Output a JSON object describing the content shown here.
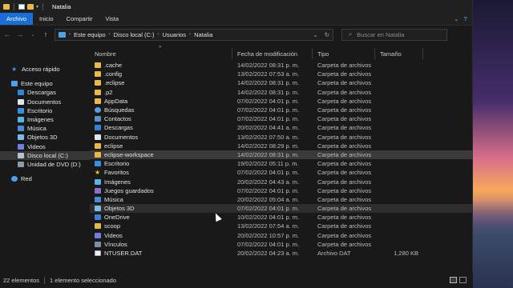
{
  "window": {
    "title": "Natalia"
  },
  "ribbon": {
    "tabs": [
      {
        "label": "Archivo",
        "active": true
      },
      {
        "label": "Inicio",
        "active": false
      },
      {
        "label": "Compartir",
        "active": false
      },
      {
        "label": "Vista",
        "active": false
      }
    ],
    "help_label": "?"
  },
  "address": {
    "crumbs": [
      "Este equipo",
      "Disco local (C:)",
      "Usuarios",
      "Natalia"
    ],
    "search_placeholder": "Buscar en Natalia"
  },
  "sidebar": {
    "items": [
      {
        "label": "Acceso rápido",
        "icon": "star-icon",
        "level": 1,
        "selected": false
      },
      {
        "label": "Este equipo",
        "icon": "computer-icon",
        "level": 1,
        "selected": false
      },
      {
        "label": "Descargas",
        "icon": "download-icon",
        "level": 2,
        "selected": false
      },
      {
        "label": "Documentos",
        "icon": "documents-icon",
        "level": 2,
        "selected": false
      },
      {
        "label": "Escritorio",
        "icon": "desktop-icon",
        "level": 2,
        "selected": false
      },
      {
        "label": "Imágenes",
        "icon": "pictures-icon",
        "level": 2,
        "selected": false
      },
      {
        "label": "Música",
        "icon": "music-icon",
        "level": 2,
        "selected": false
      },
      {
        "label": "Objetos 3D",
        "icon": "objects-3d-icon",
        "level": 2,
        "selected": false
      },
      {
        "label": "Videos",
        "icon": "video-icon",
        "level": 2,
        "selected": false
      },
      {
        "label": "Disco local (C:)",
        "icon": "drive-icon",
        "level": 2,
        "selected": true
      },
      {
        "label": "Unidad de DVD (D:)",
        "icon": "dvd-icon",
        "level": 2,
        "selected": false
      },
      {
        "label": "Red",
        "icon": "network-icon",
        "level": 1,
        "selected": false
      }
    ]
  },
  "columns": {
    "name": "Nombre",
    "date": "Fecha de modificación",
    "type": "Tipo",
    "size": "Tamaño"
  },
  "files": [
    {
      "name": ".cache",
      "date": "14/02/2022 08:31 p. m.",
      "type": "Carpeta de archivos",
      "size": "",
      "icon": "folder"
    },
    {
      "name": ".config",
      "date": "13/02/2022 07:53 a. m.",
      "type": "Carpeta de archivos",
      "size": "",
      "icon": "folder"
    },
    {
      "name": ".eclipse",
      "date": "14/02/2022 08:31 p. m.",
      "type": "Carpeta de archivos",
      "size": "",
      "icon": "folder"
    },
    {
      "name": ".p2",
      "date": "14/02/2022 08:31 p. m.",
      "type": "Carpeta de archivos",
      "size": "",
      "icon": "folder"
    },
    {
      "name": "AppData",
      "date": "07/02/2022 04:01 p. m.",
      "type": "Carpeta de archivos",
      "size": "",
      "icon": "folder"
    },
    {
      "name": "Búsquedas",
      "date": "07/02/2022 04:01 p. m.",
      "type": "Carpeta de archivos",
      "size": "",
      "icon": "searches"
    },
    {
      "name": "Contactos",
      "date": "07/02/2022 04:01 p. m.",
      "type": "Carpeta de archivos",
      "size": "",
      "icon": "contacts"
    },
    {
      "name": "Descargas",
      "date": "20/02/2022 04:41 a. m.",
      "type": "Carpeta de archivos",
      "size": "",
      "icon": "downloads"
    },
    {
      "name": "Documentos",
      "date": "13/02/2022 07:50 a. m.",
      "type": "Carpeta de archivos",
      "size": "",
      "icon": "documents"
    },
    {
      "name": "eclipse",
      "date": "14/02/2022 08:29 p. m.",
      "type": "Carpeta de archivos",
      "size": "",
      "icon": "folder"
    },
    {
      "name": "eclipse-workspace",
      "date": "14/02/2022 08:31 p. m.",
      "type": "Carpeta de archivos",
      "size": "",
      "icon": "folder",
      "highlight": true
    },
    {
      "name": "Escritorio",
      "date": "19/02/2022 05:11 p. m.",
      "type": "Carpeta de archivos",
      "size": "",
      "icon": "desktop"
    },
    {
      "name": "Favoritos",
      "date": "07/02/2022 04:01 p. m.",
      "type": "Carpeta de archivos",
      "size": "",
      "icon": "favorites"
    },
    {
      "name": "Imágenes",
      "date": "20/02/2022 04:43 a. m.",
      "type": "Carpeta de archivos",
      "size": "",
      "icon": "pictures"
    },
    {
      "name": "Juegos guardados",
      "date": "07/02/2022 04:01 p. m.",
      "type": "Carpeta de archivos",
      "size": "",
      "icon": "games"
    },
    {
      "name": "Música",
      "date": "20/02/2022 05:04 a. m.",
      "type": "Carpeta de archivos",
      "size": "",
      "icon": "music"
    },
    {
      "name": "Objetos 3D",
      "date": "07/02/2022 04:01 p. m.",
      "type": "Carpeta de archivos",
      "size": "",
      "icon": "objects3d",
      "hover": true
    },
    {
      "name": "OneDrive",
      "date": "10/02/2022 04:01 p. m.",
      "type": "Carpeta de archivos",
      "size": "",
      "icon": "onedrive"
    },
    {
      "name": "scoop",
      "date": "13/02/2022 07:54 a. m.",
      "type": "Carpeta de archivos",
      "size": "",
      "icon": "folder"
    },
    {
      "name": "Videos",
      "date": "20/02/2022 10:57 p. m.",
      "type": "Carpeta de archivos",
      "size": "",
      "icon": "videos"
    },
    {
      "name": "Vínculos",
      "date": "07/02/2022 04:01 p. m.",
      "type": "Carpeta de archivos",
      "size": "",
      "icon": "links"
    },
    {
      "name": "NTUSER.DAT",
      "date": "20/02/2022 04:23 a. m.",
      "type": "Archivo DAT",
      "size": "1,280 KB",
      "icon": "file"
    }
  ],
  "status": {
    "count": "22 elementos",
    "selection": "1 elemento seleccionado"
  },
  "colors": {
    "accent": "#1a6fd6",
    "folder": "#e8b84a",
    "background": "#191919"
  }
}
